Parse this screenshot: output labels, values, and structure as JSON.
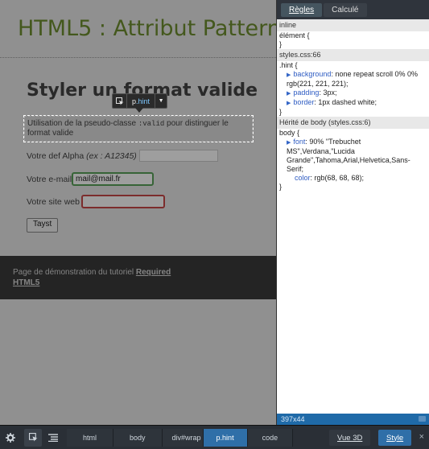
{
  "page": {
    "header_title": "HTML5 : Attribut Pattern",
    "section_title": "Styler un format valide",
    "hint": {
      "text_before": "Utilisation de la pseudo-classe ",
      "code": ":valid",
      "text_after": " pour distinguer le format valide"
    },
    "form": {
      "alpha_label": "Votre def Alpha ",
      "alpha_example": "(ex : A12345)",
      "email_label": "Votre e-mail",
      "email_value": "mail@mail.fr",
      "site_label": "Votre site web",
      "submit_label": "Tayst"
    },
    "footer": {
      "text": "Page de démonstration du tutoriel ",
      "link1": "Required",
      "link2": "HTML5"
    }
  },
  "tooltip": {
    "element": "p",
    "class": ".hint"
  },
  "panel": {
    "tabs": [
      {
        "label": "Règles"
      },
      {
        "label": "Calculé"
      }
    ],
    "rules": {
      "inline_header": "inline",
      "inline_line1": "élément {",
      "inline_line2": "}",
      "styles_header": "styles.css:66",
      "hint_selector": ".hint {",
      "hint_bg_name": "background",
      "hint_bg_value": ": none repeat scroll 0% 0% rgb(221, 221, 221);",
      "hint_pad_name": "padding",
      "hint_pad_value": ": 3px;",
      "hint_border_name": "border",
      "hint_border_value": ": 1px dashed white;",
      "hint_close": "}",
      "inherit_header": "Hérité de body (styles.css:6)",
      "body_selector": "body {",
      "body_font_name": "font",
      "body_font_value": ": 90% \"Trebuchet MS\",Verdana,\"Lucida Grande\",Tahoma,Arial,Helvetica,Sans-Serif;",
      "body_color_name": "color",
      "body_color_value": ": rgb(68, 68, 68);",
      "body_close": "}"
    },
    "dimensions": "397x44"
  },
  "toolbar": {
    "crumbs": [
      "html",
      "body",
      "div#wrap",
      "p.hint",
      "code"
    ],
    "btn_3d": "Vue 3D",
    "btn_style": "Style",
    "close": "×"
  },
  "colors": {
    "accent": "#2f6fa8",
    "title_green": "#6f8f2f",
    "valid": "#5aa25a",
    "invalid": "#c84848"
  }
}
